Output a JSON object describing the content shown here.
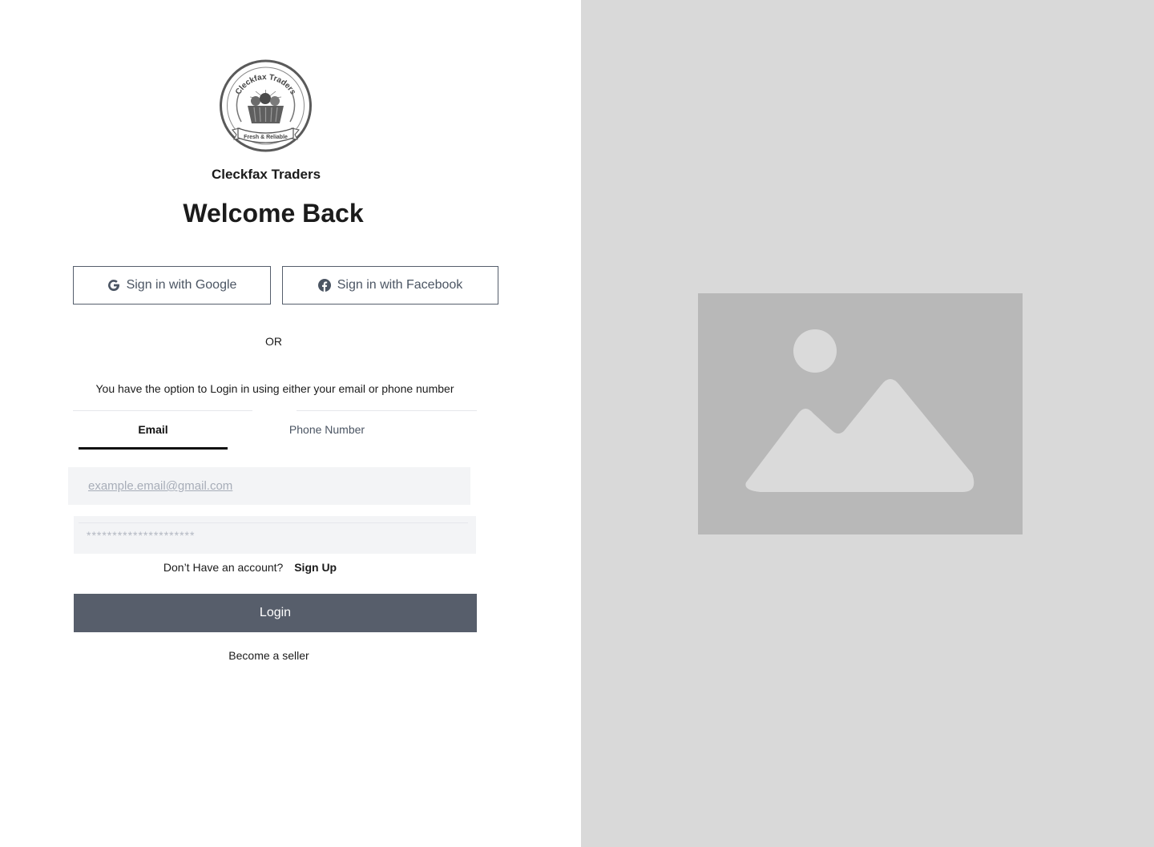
{
  "brand": {
    "name": "Cleckfax Traders",
    "logo_top_text": "Cleckfax Traders",
    "logo_ribbon_text": "Fresh & Reliable"
  },
  "heading": "Welcome Back",
  "social": {
    "google_label": "Sign in with Google",
    "facebook_label": "Sign in with Facebook"
  },
  "divider_text": "OR",
  "option_text": "You have the option to Login in using either your email or phone number",
  "tabs": [
    {
      "label": "Email",
      "active": true
    },
    {
      "label": "Phone Number",
      "active": false
    }
  ],
  "email_field": {
    "placeholder": "example.email@gmail.com"
  },
  "password_field": {
    "placeholder": "*********************"
  },
  "signup": {
    "prompt": "Don’t Have an account?",
    "link": "Sign Up"
  },
  "login_label": "Login",
  "seller_link": "Become a seller",
  "colors": {
    "right_panel": "#d9d9d9",
    "login_button": "#575e6b",
    "input_background": "#f3f4f6",
    "image_placeholder": "#b8b8b8"
  },
  "icons": {
    "google": "google-icon",
    "facebook": "facebook-icon",
    "hero": "image-placeholder-icon"
  }
}
